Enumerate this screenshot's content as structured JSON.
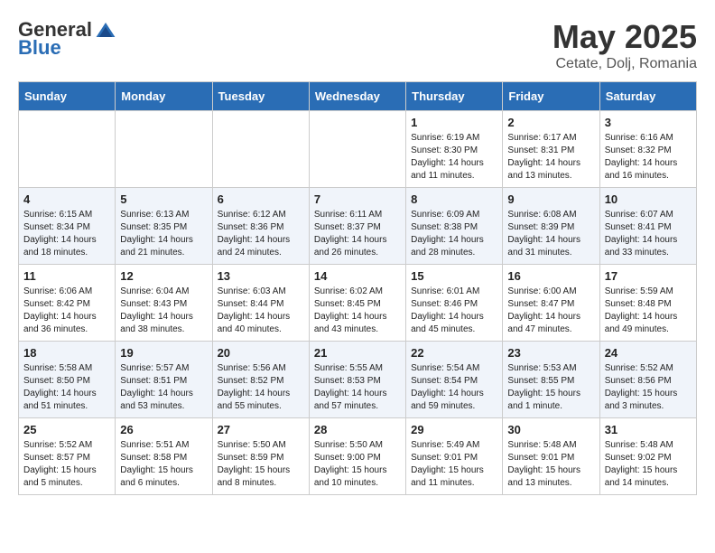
{
  "header": {
    "logo_general": "General",
    "logo_blue": "Blue",
    "month_title": "May 2025",
    "subtitle": "Cetate, Dolj, Romania"
  },
  "days_of_week": [
    "Sunday",
    "Monday",
    "Tuesday",
    "Wednesday",
    "Thursday",
    "Friday",
    "Saturday"
  ],
  "weeks": [
    [
      {
        "day": "",
        "info": ""
      },
      {
        "day": "",
        "info": ""
      },
      {
        "day": "",
        "info": ""
      },
      {
        "day": "",
        "info": ""
      },
      {
        "day": "1",
        "info": "Sunrise: 6:19 AM\nSunset: 8:30 PM\nDaylight: 14 hours\nand 11 minutes."
      },
      {
        "day": "2",
        "info": "Sunrise: 6:17 AM\nSunset: 8:31 PM\nDaylight: 14 hours\nand 13 minutes."
      },
      {
        "day": "3",
        "info": "Sunrise: 6:16 AM\nSunset: 8:32 PM\nDaylight: 14 hours\nand 16 minutes."
      }
    ],
    [
      {
        "day": "4",
        "info": "Sunrise: 6:15 AM\nSunset: 8:34 PM\nDaylight: 14 hours\nand 18 minutes."
      },
      {
        "day": "5",
        "info": "Sunrise: 6:13 AM\nSunset: 8:35 PM\nDaylight: 14 hours\nand 21 minutes."
      },
      {
        "day": "6",
        "info": "Sunrise: 6:12 AM\nSunset: 8:36 PM\nDaylight: 14 hours\nand 24 minutes."
      },
      {
        "day": "7",
        "info": "Sunrise: 6:11 AM\nSunset: 8:37 PM\nDaylight: 14 hours\nand 26 minutes."
      },
      {
        "day": "8",
        "info": "Sunrise: 6:09 AM\nSunset: 8:38 PM\nDaylight: 14 hours\nand 28 minutes."
      },
      {
        "day": "9",
        "info": "Sunrise: 6:08 AM\nSunset: 8:39 PM\nDaylight: 14 hours\nand 31 minutes."
      },
      {
        "day": "10",
        "info": "Sunrise: 6:07 AM\nSunset: 8:41 PM\nDaylight: 14 hours\nand 33 minutes."
      }
    ],
    [
      {
        "day": "11",
        "info": "Sunrise: 6:06 AM\nSunset: 8:42 PM\nDaylight: 14 hours\nand 36 minutes."
      },
      {
        "day": "12",
        "info": "Sunrise: 6:04 AM\nSunset: 8:43 PM\nDaylight: 14 hours\nand 38 minutes."
      },
      {
        "day": "13",
        "info": "Sunrise: 6:03 AM\nSunset: 8:44 PM\nDaylight: 14 hours\nand 40 minutes."
      },
      {
        "day": "14",
        "info": "Sunrise: 6:02 AM\nSunset: 8:45 PM\nDaylight: 14 hours\nand 43 minutes."
      },
      {
        "day": "15",
        "info": "Sunrise: 6:01 AM\nSunset: 8:46 PM\nDaylight: 14 hours\nand 45 minutes."
      },
      {
        "day": "16",
        "info": "Sunrise: 6:00 AM\nSunset: 8:47 PM\nDaylight: 14 hours\nand 47 minutes."
      },
      {
        "day": "17",
        "info": "Sunrise: 5:59 AM\nSunset: 8:48 PM\nDaylight: 14 hours\nand 49 minutes."
      }
    ],
    [
      {
        "day": "18",
        "info": "Sunrise: 5:58 AM\nSunset: 8:50 PM\nDaylight: 14 hours\nand 51 minutes."
      },
      {
        "day": "19",
        "info": "Sunrise: 5:57 AM\nSunset: 8:51 PM\nDaylight: 14 hours\nand 53 minutes."
      },
      {
        "day": "20",
        "info": "Sunrise: 5:56 AM\nSunset: 8:52 PM\nDaylight: 14 hours\nand 55 minutes."
      },
      {
        "day": "21",
        "info": "Sunrise: 5:55 AM\nSunset: 8:53 PM\nDaylight: 14 hours\nand 57 minutes."
      },
      {
        "day": "22",
        "info": "Sunrise: 5:54 AM\nSunset: 8:54 PM\nDaylight: 14 hours\nand 59 minutes."
      },
      {
        "day": "23",
        "info": "Sunrise: 5:53 AM\nSunset: 8:55 PM\nDaylight: 15 hours\nand 1 minute."
      },
      {
        "day": "24",
        "info": "Sunrise: 5:52 AM\nSunset: 8:56 PM\nDaylight: 15 hours\nand 3 minutes."
      }
    ],
    [
      {
        "day": "25",
        "info": "Sunrise: 5:52 AM\nSunset: 8:57 PM\nDaylight: 15 hours\nand 5 minutes."
      },
      {
        "day": "26",
        "info": "Sunrise: 5:51 AM\nSunset: 8:58 PM\nDaylight: 15 hours\nand 6 minutes."
      },
      {
        "day": "27",
        "info": "Sunrise: 5:50 AM\nSunset: 8:59 PM\nDaylight: 15 hours\nand 8 minutes."
      },
      {
        "day": "28",
        "info": "Sunrise: 5:50 AM\nSunset: 9:00 PM\nDaylight: 15 hours\nand 10 minutes."
      },
      {
        "day": "29",
        "info": "Sunrise: 5:49 AM\nSunset: 9:01 PM\nDaylight: 15 hours\nand 11 minutes."
      },
      {
        "day": "30",
        "info": "Sunrise: 5:48 AM\nSunset: 9:01 PM\nDaylight: 15 hours\nand 13 minutes."
      },
      {
        "day": "31",
        "info": "Sunrise: 5:48 AM\nSunset: 9:02 PM\nDaylight: 15 hours\nand 14 minutes."
      }
    ]
  ]
}
